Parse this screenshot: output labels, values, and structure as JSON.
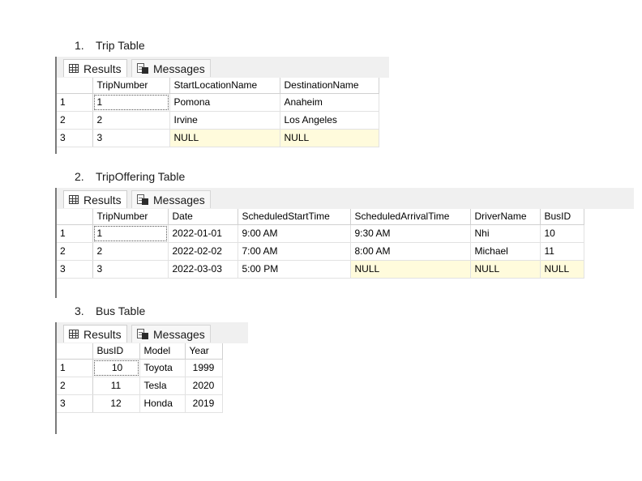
{
  "sections": [
    {
      "number": "1.",
      "title": "Trip Table",
      "tabs": {
        "results": "Results",
        "messages": "Messages"
      },
      "columns": [
        "TripNumber",
        "StartLocationName",
        "DestinationName"
      ],
      "rows": [
        {
          "rownum": "1",
          "cells": [
            "1",
            "Pomona",
            "Anaheim"
          ]
        },
        {
          "rownum": "2",
          "cells": [
            "2",
            "Irvine",
            "Los Angeles"
          ]
        },
        {
          "rownum": "3",
          "cells": [
            "3",
            "NULL",
            "NULL"
          ]
        }
      ]
    },
    {
      "number": "2.",
      "title": "TripOffering Table",
      "tabs": {
        "results": "Results",
        "messages": "Messages"
      },
      "columns": [
        "TripNumber",
        "Date",
        "ScheduledStartTime",
        "ScheduledArrivalTime",
        "DriverName",
        "BusID"
      ],
      "rows": [
        {
          "rownum": "1",
          "cells": [
            "1",
            "2022-01-01",
            "9:00 AM",
            "9:30 AM",
            "Nhi",
            "10"
          ]
        },
        {
          "rownum": "2",
          "cells": [
            "2",
            "2022-02-02",
            "7:00 AM",
            "8:00 AM",
            "Michael",
            "11"
          ]
        },
        {
          "rownum": "3",
          "cells": [
            "3",
            "2022-03-03",
            "5:00 PM",
            "NULL",
            "NULL",
            "NULL"
          ]
        }
      ]
    },
    {
      "number": "3.",
      "title": "Bus Table",
      "tabs": {
        "results": "Results",
        "messages": "Messages"
      },
      "columns": [
        "BusID",
        "Model",
        "Year"
      ],
      "rows": [
        {
          "rownum": "1",
          "cells": [
            "10",
            "Toyota",
            "1999"
          ]
        },
        {
          "rownum": "2",
          "cells": [
            "11",
            "Tesla",
            "2020"
          ]
        },
        {
          "rownum": "3",
          "cells": [
            "12",
            "Honda",
            "2019"
          ]
        }
      ]
    }
  ],
  "colors": {
    "null_highlight": "#fffbdc",
    "panel_bg": "#f0f0f0",
    "grid_line": "#e2e2e2"
  }
}
